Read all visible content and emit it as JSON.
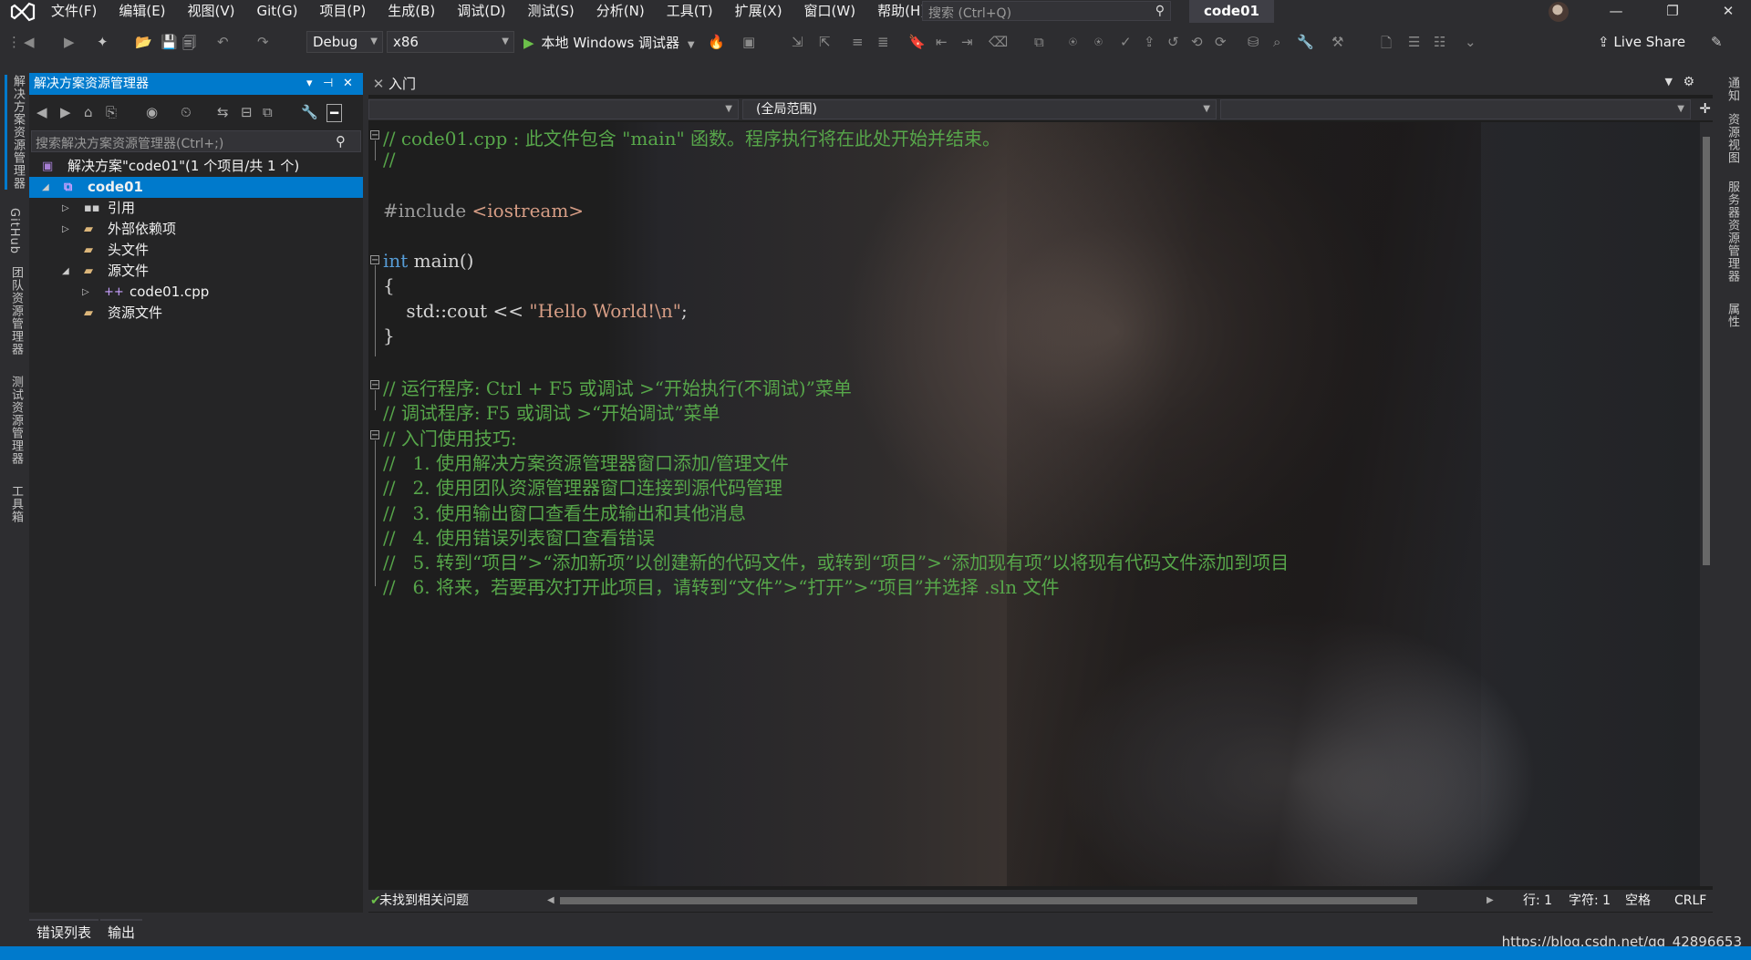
{
  "menu": [
    "文件(F)",
    "编辑(E)",
    "视图(V)",
    "Git(G)",
    "项目(P)",
    "生成(B)",
    "调试(D)",
    "测试(S)",
    "分析(N)",
    "工具(T)",
    "扩展(X)",
    "窗口(W)",
    "帮助(H)"
  ],
  "search": {
    "placeholder": "搜索 (Ctrl+Q)"
  },
  "solution_name": "code01",
  "toolbar": {
    "config": "Debug",
    "platform": "x86",
    "run_label": "本地 Windows 调试器",
    "live_share": "Live Share"
  },
  "left_tabs": [
    "解决方案资源管理器",
    "GitHub",
    "团队资源管理器",
    "测试资源管理器",
    "工具箱"
  ],
  "right_tabs": [
    "通知",
    "资源视图",
    "服务器资源管理器",
    "属性"
  ],
  "solution_explorer": {
    "title": "解决方案资源管理器",
    "search_placeholder": "搜索解决方案资源管理器(Ctrl+;)",
    "tree": {
      "solution": "解决方案\"code01\"(1 个项目/共 1 个)",
      "project": "code01",
      "references": "引用",
      "external_deps": "外部依赖项",
      "headers": "头文件",
      "sources": "源文件",
      "source_file": "code01.cpp",
      "resources": "资源文件"
    }
  },
  "editor": {
    "tab_label": "入门",
    "scope": "(全局范围)",
    "code": {
      "l1": "// code01.cpp : 此文件包含 \"main\" 函数。程序执行将在此处开始并结束。",
      "l2": "//",
      "l3_a": "#include ",
      "l3_b": "<iostream>",
      "l4_kw": "int",
      "l4_rest": " main()",
      "l5": "{",
      "l6_a": "    std::cout << ",
      "l6_str": "\"Hello World!\\n\"",
      "l6_b": ";",
      "l7": "}",
      "l8": "// 运行程序: Ctrl + F5 或调试 >“开始执行(不调试)”菜单",
      "l9": "// 调试程序: F5 或调试 >“开始调试”菜单",
      "l10": "// 入门使用技巧:",
      "l11": "//   1. 使用解决方案资源管理器窗口添加/管理文件",
      "l12": "//   2. 使用团队资源管理器窗口连接到源代码管理",
      "l13": "//   3. 使用输出窗口查看生成输出和其他消息",
      "l14": "//   4. 使用错误列表窗口查看错误",
      "l15": "//   5. 转到“项目”>“添加新项”以创建新的代码文件，或转到“项目”>“添加现有项”以将现有代码文件添加到项目",
      "l16": "//   6. 将来，若要再次打开此项目，请转到“文件”>“打开”>“项目”并选择 .sln 文件"
    },
    "status": {
      "issues": "未找到相关问题",
      "line": "行: 1",
      "col": "字符: 1",
      "spacing": "空格",
      "eol": "CRLF"
    }
  },
  "bottom_tabs": [
    "错误列表",
    "输出"
  ],
  "watermark_url": "https://blog.csdn.net/qq_42896653",
  "colors": {
    "accent": "#007acc",
    "comment": "#57a64a",
    "keyword": "#569cd6",
    "string": "#d69d85"
  }
}
